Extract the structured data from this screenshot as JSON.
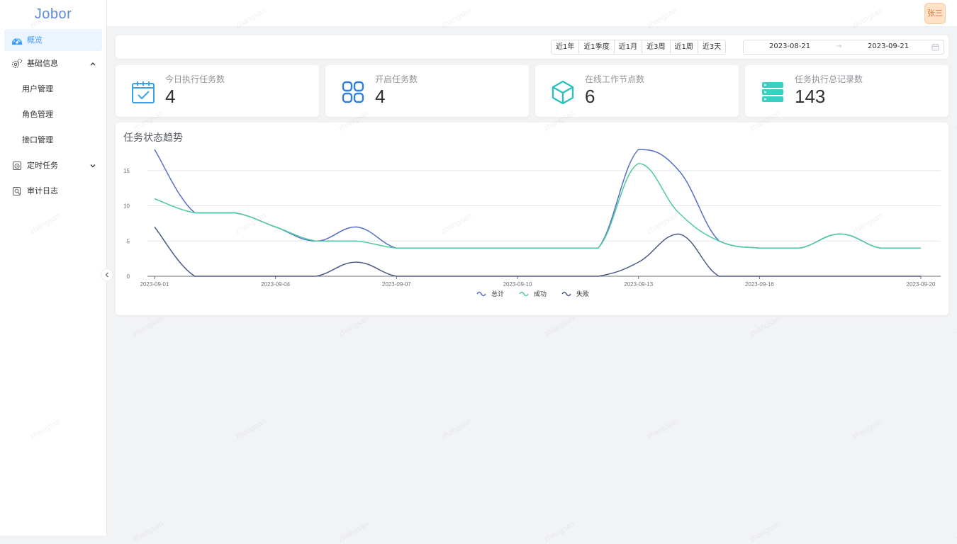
{
  "app": {
    "logo": "Jobor"
  },
  "user": {
    "name": "张三"
  },
  "sidebar": {
    "items": [
      {
        "label": "概览",
        "icon": "dashboard-icon",
        "active": true
      },
      {
        "label": "基础信息",
        "icon": "settings-gear-icon",
        "expanded": true
      },
      {
        "label": "用户管理",
        "sub": true
      },
      {
        "label": "角色管理",
        "sub": true
      },
      {
        "label": "接口管理",
        "sub": true
      },
      {
        "label": "定时任务",
        "icon": "timer-icon",
        "expanded": false
      },
      {
        "label": "审计日志",
        "icon": "audit-log-icon"
      }
    ]
  },
  "filters": {
    "ranges": [
      "近1年",
      "近1季度",
      "近1月",
      "近3周",
      "近1周",
      "近3天"
    ],
    "date_start": "2023-08-21",
    "date_separator": "→",
    "date_end": "2023-09-21"
  },
  "stats": [
    {
      "label": "今日执行任务数",
      "value": "4",
      "icon": "calendar-check-icon",
      "color": "#3ba0e6"
    },
    {
      "label": "开启任务数",
      "value": "4",
      "icon": "grid-apps-icon",
      "color": "#2f7fe0"
    },
    {
      "label": "在线工作节点数",
      "value": "6",
      "icon": "cube-icon",
      "color": "#2ec0c0"
    },
    {
      "label": "任务执行总记录数",
      "value": "143",
      "icon": "server-stack-icon",
      "color": "#36d1c0"
    }
  ],
  "watermark": "zhangsan",
  "chart_data": {
    "type": "line",
    "title": "任务状态趋势",
    "smooth": true,
    "x": [
      "2023-09-01",
      "2023-09-02",
      "2023-09-03",
      "2023-09-04",
      "2023-09-05",
      "2023-09-06",
      "2023-09-07",
      "2023-09-08",
      "2023-09-09",
      "2023-09-10",
      "2023-09-11",
      "2023-09-12",
      "2023-09-13",
      "2023-09-14",
      "2023-09-15",
      "2023-09-16",
      "2023-09-17",
      "2023-09-18",
      "2023-09-19",
      "2023-09-20"
    ],
    "x_tick_labels": [
      "2023-09-01",
      "2023-09-04",
      "2023-09-07",
      "2023-09-10",
      "2023-09-13",
      "2023-09-16",
      "2023-09-20"
    ],
    "y_ticks": [
      0,
      5,
      10,
      15
    ],
    "ylim": [
      0,
      18
    ],
    "grid": true,
    "legend_position": "bottom",
    "series": [
      {
        "name": "总计",
        "color": "#5470c6",
        "values": [
          18,
          9,
          9,
          7,
          5,
          7,
          4,
          4,
          4,
          4,
          4,
          4,
          18,
          15,
          5,
          4,
          4,
          6,
          4,
          4
        ]
      },
      {
        "name": "成功",
        "color": "#4ecb9e",
        "values": [
          11,
          9,
          9,
          7,
          5,
          5,
          4,
          4,
          4,
          4,
          4,
          4,
          16,
          9,
          5,
          4,
          4,
          6,
          4,
          4
        ]
      },
      {
        "name": "失败",
        "color": "#4a5b85",
        "values": [
          7,
          0,
          0,
          0,
          0,
          2,
          0,
          0,
          0,
          0,
          0,
          0,
          2,
          6,
          0,
          0,
          0,
          0,
          0,
          0
        ]
      }
    ]
  }
}
